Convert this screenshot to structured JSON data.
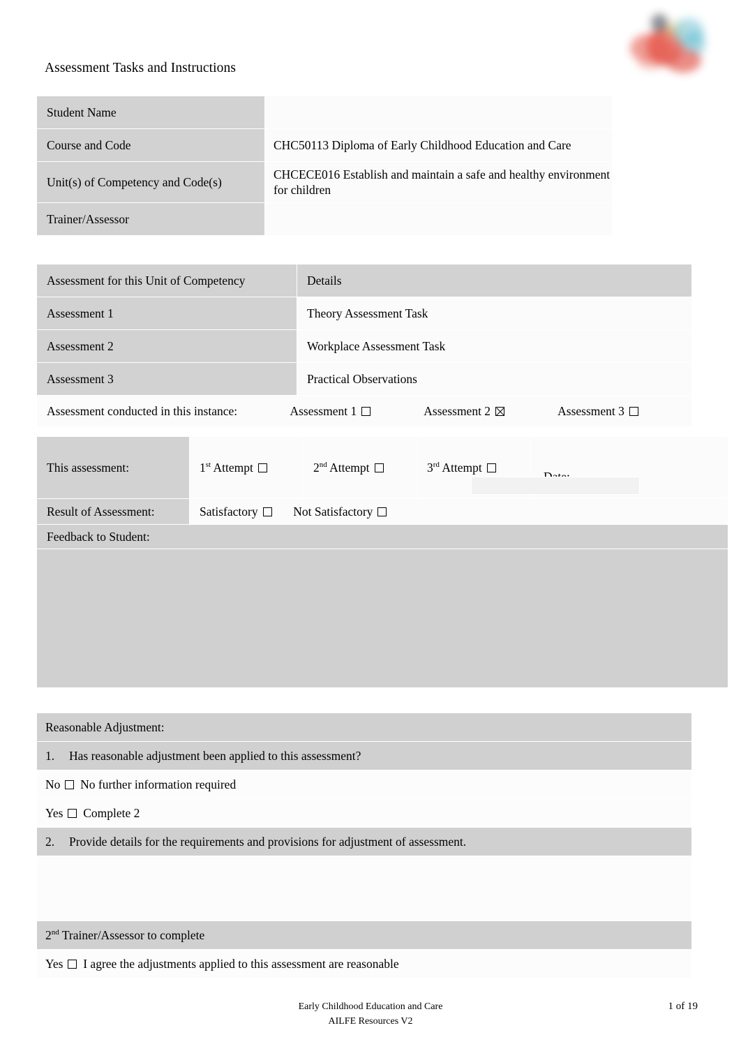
{
  "document": {
    "title": "Assessment Tasks and Instructions",
    "logo_alt": "organisation-logo"
  },
  "student_details": {
    "rows": [
      {
        "label": "Student Name",
        "value": ""
      },
      {
        "label": "Course and Code",
        "value": "CHC50113 Diploma of Early Childhood Education and Care"
      },
      {
        "label": "Unit(s) of Competency and Code(s)",
        "value": "CHCECE016 Establish and maintain a safe and healthy environment for children"
      },
      {
        "label": "Trainer/Assessor",
        "value": ""
      }
    ]
  },
  "assessments": {
    "header": {
      "col1": "Assessment for this Unit of Competency",
      "col2": "Details"
    },
    "rows": [
      {
        "label": "Assessment 1",
        "detail": "Theory Assessment Task"
      },
      {
        "label": "Assessment 2",
        "detail": "Workplace Assessment Task"
      },
      {
        "label": "Assessment 3",
        "detail": "Practical Observations"
      }
    ],
    "conducted": {
      "question": "Assessment conducted in this instance:",
      "options": [
        {
          "label": "Assessment 1",
          "checked": false
        },
        {
          "label": "Assessment 2",
          "checked": true
        },
        {
          "label": "Assessment 3",
          "checked": false
        }
      ]
    }
  },
  "attempt": {
    "this_assessment_label": "This assessment:",
    "attempts": [
      {
        "ordinal": "1",
        "suffix": "st",
        "label": "Attempt",
        "checked": false
      },
      {
        "ordinal": "2",
        "suffix": "nd",
        "label": "Attempt",
        "checked": false
      },
      {
        "ordinal": "3",
        "suffix": "rd",
        "label": "Attempt",
        "checked": false
      }
    ],
    "date_label": "Date:",
    "date_value": "",
    "result_label": "Result of Assessment:",
    "result_options": [
      {
        "label": "Satisfactory",
        "checked": false
      },
      {
        "label": "Not Satisfactory",
        "checked": false
      }
    ],
    "feedback_label": "Feedback to Student:",
    "feedback_value": ""
  },
  "reasonable_adjustment": {
    "heading": "Reasonable Adjustment:",
    "q1_number": "1.",
    "q1_text": "Has reasonable adjustment been applied to this assessment?",
    "no_label": "No",
    "no_text": "No further information required",
    "yes_label": "Yes",
    "yes_text": "Complete 2",
    "q2_number": "2.",
    "q2_text": "Provide details for the requirements and provisions for adjustment of assessment.",
    "details_value": "",
    "trainer_ordinal": "2",
    "trainer_suffix": "nd",
    "trainer_text": "Trainer/Assessor to complete",
    "agree_label": "Yes",
    "agree_text": "I agree the adjustments applied to this assessment are reasonable"
  },
  "footer": {
    "line1": "Early Childhood Education and Care",
    "line2": "AILFE Resources V2",
    "page": "1 of 19"
  }
}
